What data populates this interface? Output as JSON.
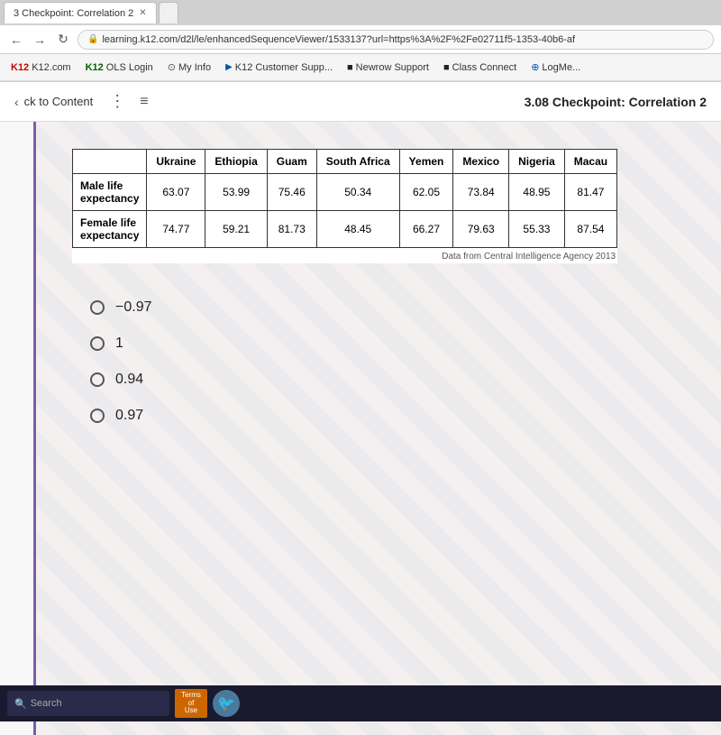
{
  "browser": {
    "tabs": [
      {
        "id": "tab1",
        "label": "3 Checkpoint: Correlation 2",
        "active": true
      },
      {
        "id": "tab2",
        "label": "",
        "active": false
      }
    ],
    "url": "learning.k12.com/d2l/le/enhancedSequenceViewer/1533137?url=https%3A%2F%2Fe02711f5-1353-40b6-af",
    "bookmarks": [
      {
        "id": "k12com",
        "label": "K12.com",
        "icon": "K12",
        "color": "red"
      },
      {
        "id": "olslogin",
        "label": "OLS Login",
        "icon": "K12",
        "color": "green"
      },
      {
        "id": "myinfo",
        "label": "My Info",
        "icon": "●"
      },
      {
        "id": "k12support",
        "label": "K12 Customer Supp...",
        "icon": "▶"
      },
      {
        "id": "newrowsupport",
        "label": "Newrow Support",
        "icon": "■"
      },
      {
        "id": "classconnect",
        "label": "Class Connect",
        "icon": "■"
      },
      {
        "id": "logmel",
        "label": "LogMe...",
        "icon": "⊕"
      }
    ]
  },
  "header": {
    "back_label": "ck to Content",
    "page_title": "3.08 Checkpoint: Correlation 2"
  },
  "table": {
    "columns": [
      "",
      "Ukraine",
      "Ethiopia",
      "Guam",
      "South Africa",
      "Yemen",
      "Mexico",
      "Nigeria",
      "Macau"
    ],
    "rows": [
      {
        "label": "Male life expectancy",
        "values": [
          "63.07",
          "53.99",
          "75.46",
          "50.34",
          "62.05",
          "73.84",
          "48.95",
          "81.47"
        ]
      },
      {
        "label": "Female life expectancy",
        "values": [
          "74.77",
          "59.21",
          "81.73",
          "48.45",
          "66.27",
          "79.63",
          "55.33",
          "87.54"
        ]
      }
    ],
    "citation": "Data from Central Intelligence Agency 2013"
  },
  "choices": [
    {
      "id": "choice1",
      "value": "−0.97"
    },
    {
      "id": "choice2",
      "value": "1"
    },
    {
      "id": "choice3",
      "value": "0.94"
    },
    {
      "id": "choice4",
      "value": "0.97"
    }
  ],
  "taskbar": {
    "search_placeholder": "Search",
    "terms_line1": "Terms",
    "terms_line2": "of",
    "terms_line3": "Use"
  }
}
